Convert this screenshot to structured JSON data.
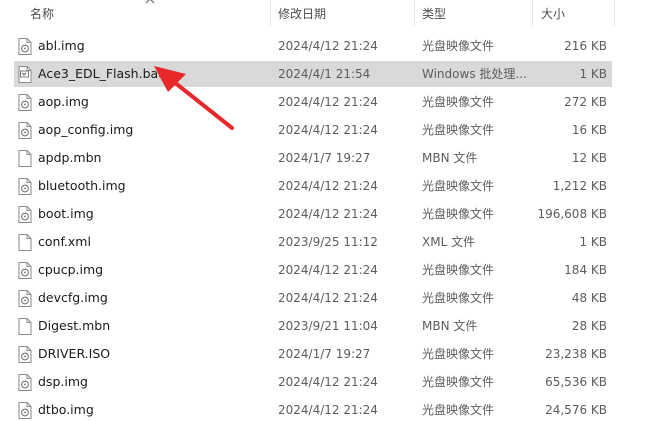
{
  "header": {
    "name": "名称",
    "date": "修改日期",
    "type": "类型",
    "size": "大小"
  },
  "files": [
    {
      "name": "abl.img",
      "date": "2024/4/12 21:24",
      "type": "光盘映像文件",
      "size": "216 KB",
      "icon": "disc-image-file-icon"
    },
    {
      "name": "Ace3_EDL_Flash.bat",
      "date": "2024/4/1 21:54",
      "type": "Windows 批处理...",
      "size": "1 KB",
      "icon": "batch-file-icon",
      "highlighted": true
    },
    {
      "name": "aop.img",
      "date": "2024/4/12 21:24",
      "type": "光盘映像文件",
      "size": "272 KB",
      "icon": "disc-image-file-icon"
    },
    {
      "name": "aop_config.img",
      "date": "2024/4/12 21:24",
      "type": "光盘映像文件",
      "size": "16 KB",
      "icon": "disc-image-file-icon"
    },
    {
      "name": "apdp.mbn",
      "date": "2024/1/7 19:27",
      "type": "MBN 文件",
      "size": "12 KB",
      "icon": "blank-file-icon"
    },
    {
      "name": "bluetooth.img",
      "date": "2024/4/12 21:24",
      "type": "光盘映像文件",
      "size": "1,212 KB",
      "icon": "disc-image-file-icon"
    },
    {
      "name": "boot.img",
      "date": "2024/4/12 21:24",
      "type": "光盘映像文件",
      "size": "196,608 KB",
      "icon": "disc-image-file-icon"
    },
    {
      "name": "conf.xml",
      "date": "2023/9/25 11:12",
      "type": "XML 文件",
      "size": "1 KB",
      "icon": "blank-file-icon"
    },
    {
      "name": "cpucp.img",
      "date": "2024/4/12 21:24",
      "type": "光盘映像文件",
      "size": "184 KB",
      "icon": "disc-image-file-icon"
    },
    {
      "name": "devcfg.img",
      "date": "2024/4/12 21:24",
      "type": "光盘映像文件",
      "size": "48 KB",
      "icon": "disc-image-file-icon"
    },
    {
      "name": "Digest.mbn",
      "date": "2023/9/21 11:04",
      "type": "MBN 文件",
      "size": "28 KB",
      "icon": "blank-file-icon"
    },
    {
      "name": "DRIVER.ISO",
      "date": "2024/1/7 19:27",
      "type": "光盘映像文件",
      "size": "23,238 KB",
      "icon": "disc-image-file-icon"
    },
    {
      "name": "dsp.img",
      "date": "2024/4/12 21:24",
      "type": "光盘映像文件",
      "size": "65,536 KB",
      "icon": "disc-image-file-icon"
    },
    {
      "name": "dtbo.img",
      "date": "2024/4/12 21:24",
      "type": "光盘映像文件",
      "size": "24,576 KB",
      "icon": "disc-image-file-icon"
    }
  ],
  "colors": {
    "highlight": "#d9d9d9",
    "arrow": "#e8282b"
  }
}
